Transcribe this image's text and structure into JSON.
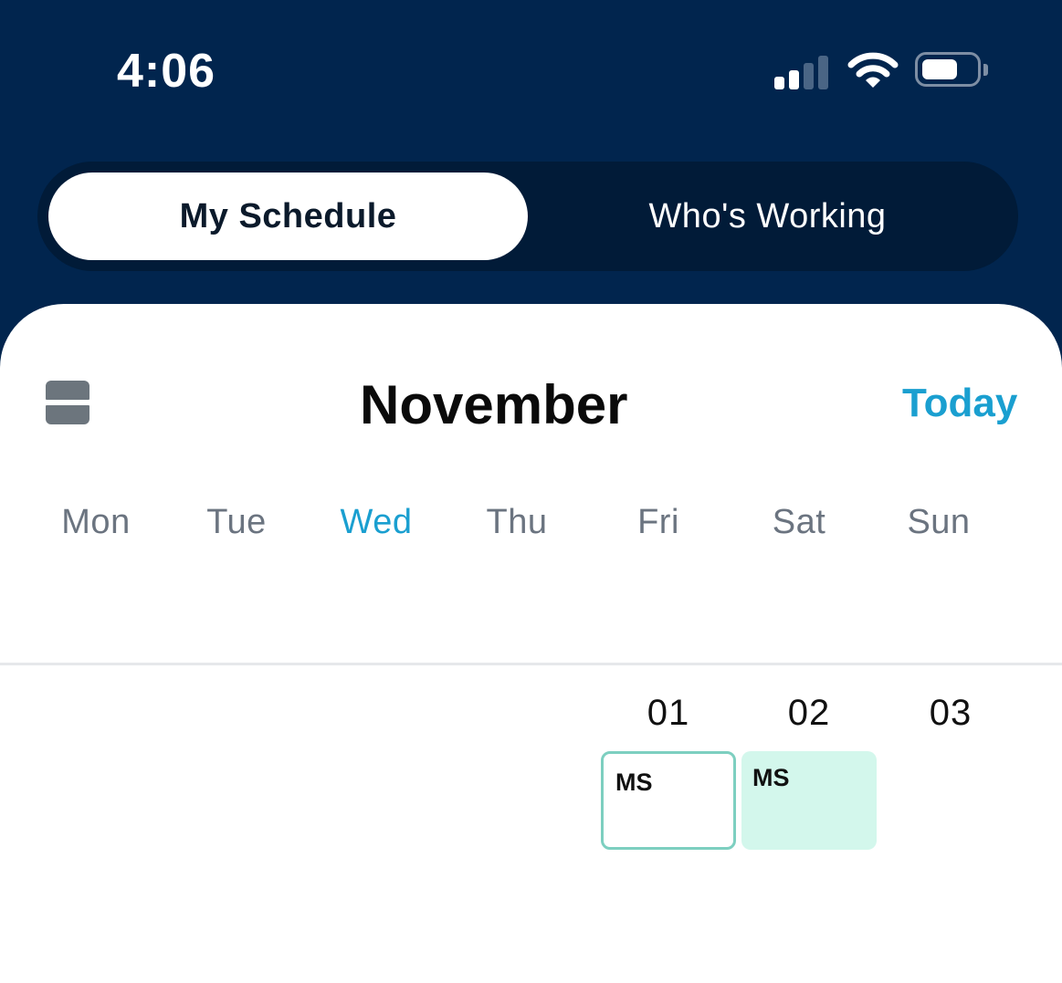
{
  "status_bar": {
    "time": "4:06",
    "signal_icon": "cellular-signal-icon",
    "wifi_icon": "wifi-icon",
    "battery_icon": "battery-icon",
    "battery_level": 0.6
  },
  "tabs": [
    {
      "label": "My Schedule",
      "active": true
    },
    {
      "label": "Who's Working",
      "active": false
    }
  ],
  "calendar": {
    "view_toggle_icon": "calendar-view-toggle-icon",
    "month": "November",
    "today_label": "Today",
    "accent_color": "#1a9fd0",
    "weekdays": [
      "Mon",
      "Tue",
      "Wed",
      "Thu",
      "Fri",
      "Sat",
      "Sun"
    ],
    "current_weekday": "Wed",
    "days": [
      {
        "number": "01",
        "weekday": "Fri",
        "shift": {
          "label": "MS",
          "style": "outline"
        }
      },
      {
        "number": "02",
        "weekday": "Sat",
        "shift": {
          "label": "MS",
          "style": "filled"
        }
      },
      {
        "number": "03",
        "weekday": "Sun",
        "shift": null
      }
    ]
  },
  "colors": {
    "header_bg": "#01254e",
    "segmented_bg": "#011b38",
    "shift_outline": "#7dcfc0",
    "shift_fill": "#d3f7ec"
  }
}
